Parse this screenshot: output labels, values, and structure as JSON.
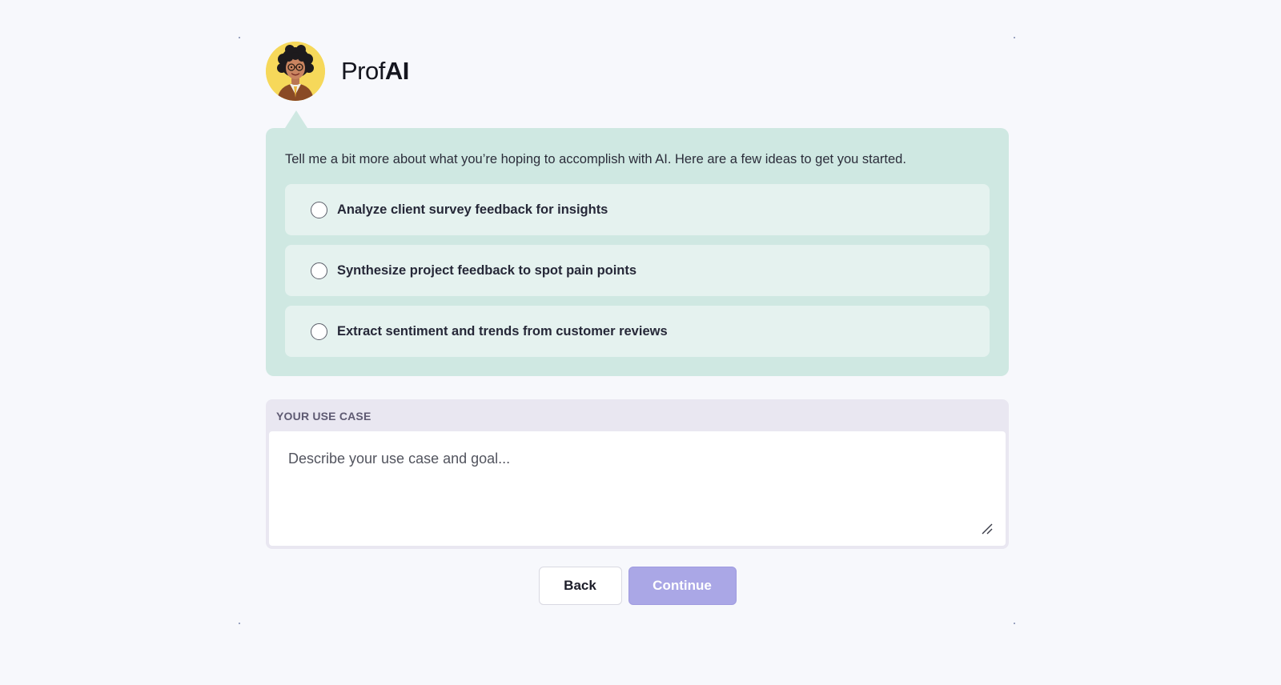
{
  "brand": {
    "light": "Prof",
    "bold": "AI",
    "avatar_icon": "illustrated-professor-avatar"
  },
  "prompt": {
    "text": "Tell me a bit more about what you’re hoping to accomplish with AI. Here are a few ideas to get you started."
  },
  "options": [
    {
      "label": "Analyze client survey feedback for insights",
      "selected": false
    },
    {
      "label": "Synthesize project feedback to spot pain points",
      "selected": false
    },
    {
      "label": "Extract sentiment and trends from customer reviews",
      "selected": false
    }
  ],
  "use_case": {
    "label": "YOUR USE CASE",
    "placeholder": "Describe your use case and goal...",
    "value": ""
  },
  "actions": {
    "back_label": "Back",
    "continue_label": "Continue"
  },
  "colors": {
    "bubble": "#cfe8e2",
    "option": "#e5f2ef",
    "continue_disabled": "#aaa7e6",
    "avatar_bg": "#f6d85a"
  }
}
